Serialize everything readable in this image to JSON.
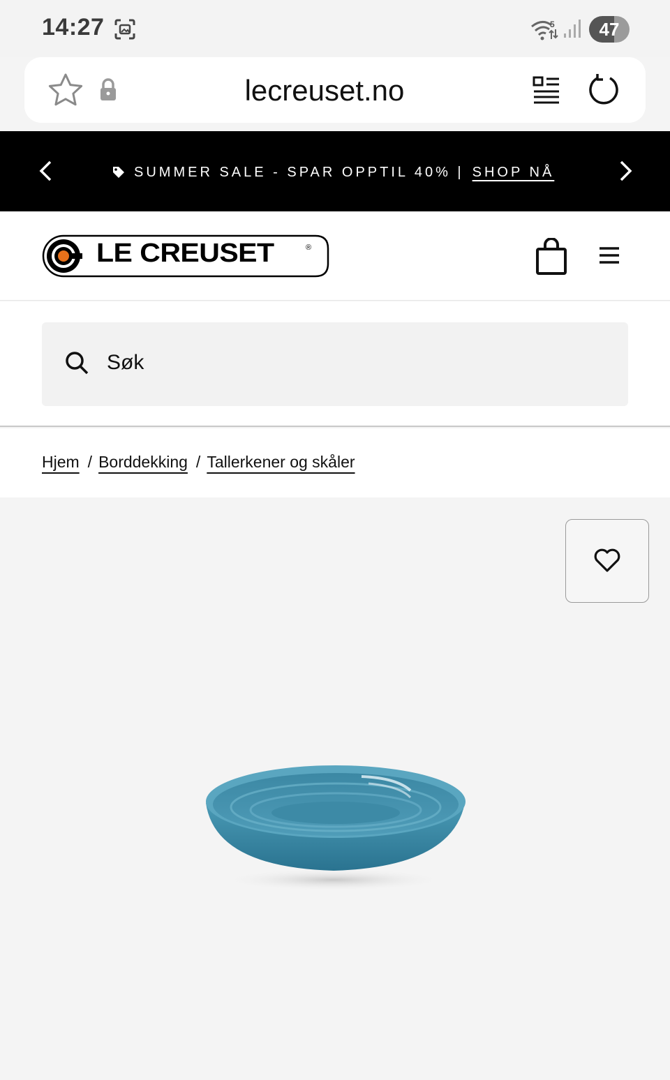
{
  "status_bar": {
    "time": "14:27",
    "battery": "47",
    "icons": [
      "screenshot-icon",
      "wifi-icon",
      "signal-icon"
    ]
  },
  "browser": {
    "url": "lecreuset.no",
    "icons": [
      "star-icon",
      "lock-icon",
      "reader-mode-icon",
      "reload-icon"
    ]
  },
  "promo": {
    "text": "SUMMER SALE - SPAR OPPTIL 40% |",
    "link": "SHOP NÅ",
    "icons": [
      "tag-icon",
      "chevron-left-icon",
      "chevron-right-icon"
    ]
  },
  "header": {
    "brand": "LE CREUSET",
    "brand_accent_color": "#e8711a",
    "icons": [
      "shopping-bag-icon",
      "hamburger-menu-icon"
    ]
  },
  "search": {
    "placeholder": "Søk"
  },
  "breadcrumb": [
    {
      "label": "Hjem"
    },
    {
      "label": "Borddekking"
    },
    {
      "label": "Tallerkener og skåler"
    }
  ],
  "product": {
    "color": "#3b8aa6",
    "icons": [
      "heart-icon"
    ]
  }
}
